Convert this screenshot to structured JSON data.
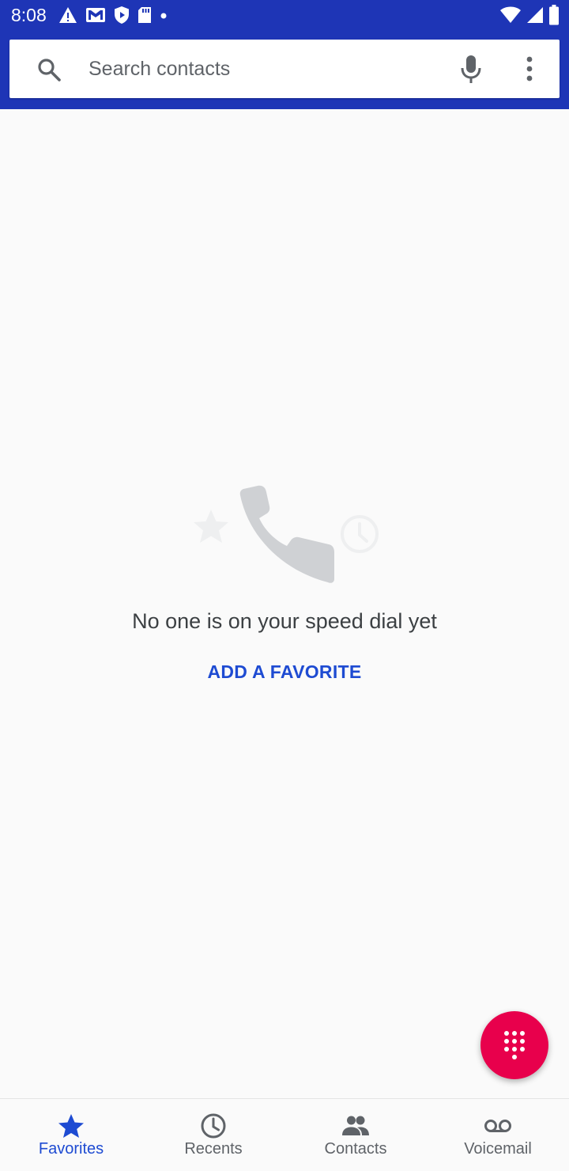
{
  "status_bar": {
    "time": "8:08",
    "background": "#1e35b6",
    "left_icons": [
      "alert-icon",
      "gmail-icon",
      "shield-icon",
      "sd-card-icon",
      "dot-icon"
    ],
    "right_icons": [
      "wifi-icon",
      "signal-icon",
      "battery-icon"
    ]
  },
  "search": {
    "placeholder": "Search contacts",
    "value": ""
  },
  "empty_state": {
    "message": "No one is on your speed dial yet",
    "action_label": "ADD A FAVORITE"
  },
  "fab": {
    "icon": "dialpad-icon",
    "color": "#e8004c"
  },
  "bottom_nav": {
    "active_index": 0,
    "accent_color": "#1e4bd2",
    "items": [
      {
        "label": "Favorites",
        "icon": "star-icon"
      },
      {
        "label": "Recents",
        "icon": "clock-icon"
      },
      {
        "label": "Contacts",
        "icon": "people-icon"
      },
      {
        "label": "Voicemail",
        "icon": "voicemail-icon"
      }
    ]
  }
}
